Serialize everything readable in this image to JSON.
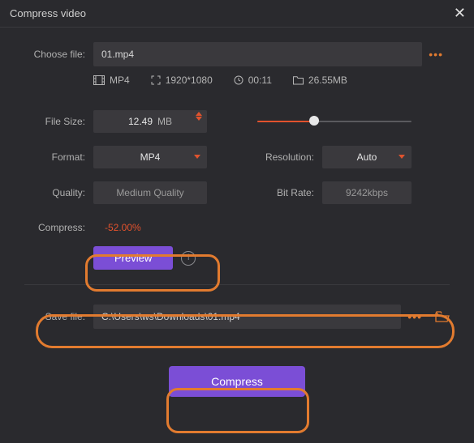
{
  "title": "Compress video",
  "choose_file": {
    "label": "Choose file:",
    "value": "01.mp4"
  },
  "meta": {
    "format": "MP4",
    "resolution": "1920*1080",
    "duration": "00:11",
    "size": "26.55MB"
  },
  "left": {
    "filesize_label": "File Size:",
    "filesize_value": "12.49",
    "filesize_unit": "MB",
    "format_label": "Format:",
    "format_value": "MP4",
    "quality_label": "Quality:",
    "quality_value": "Medium Quality"
  },
  "right": {
    "resolution_label": "Resolution:",
    "resolution_value": "Auto",
    "bitrate_label": "Bit Rate:",
    "bitrate_value": "9242kbps"
  },
  "compress": {
    "label": "Compress:",
    "value": "-52.00%"
  },
  "preview_label": "Preview",
  "savefile": {
    "label": "Save file:",
    "value": "C:\\Users\\ws\\Downloads\\01.mp4"
  },
  "compress_btn": "Compress"
}
